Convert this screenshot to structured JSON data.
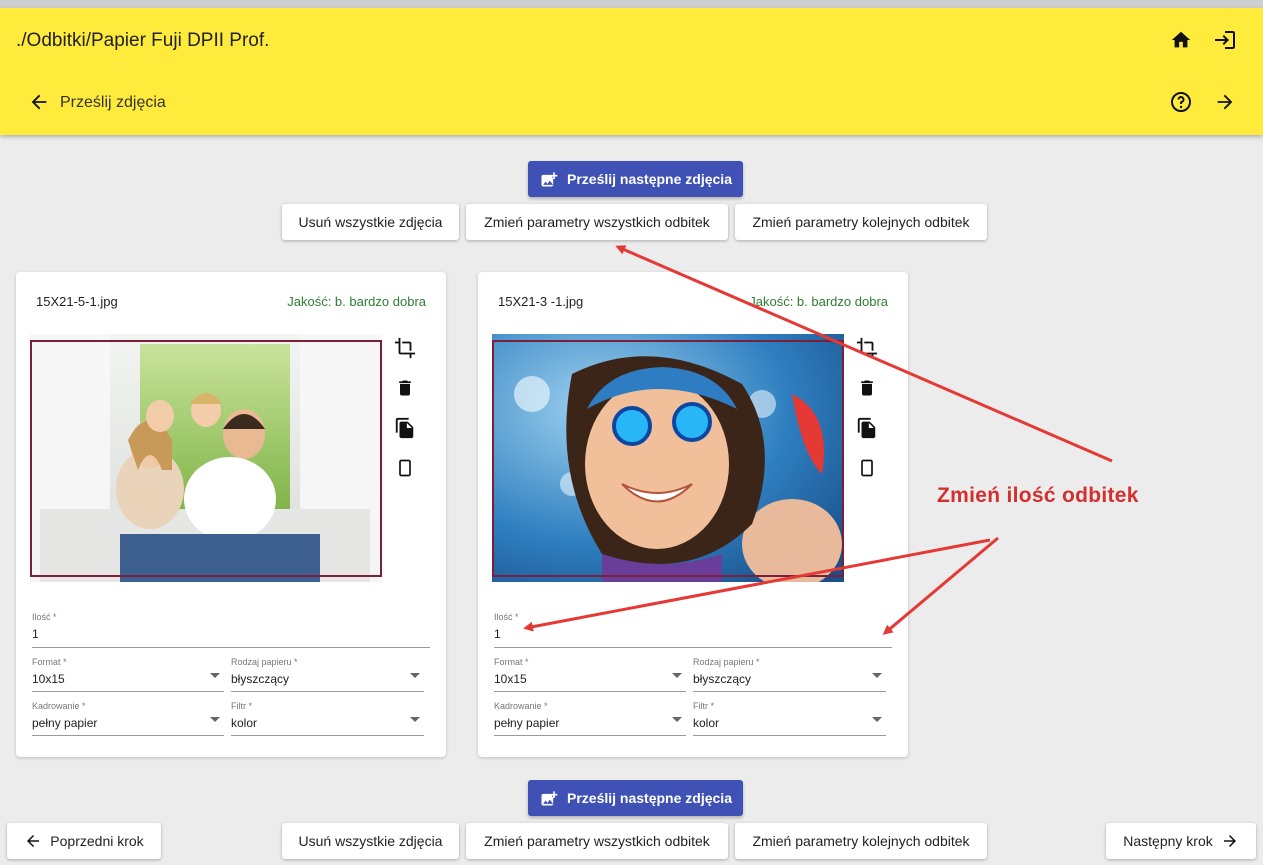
{
  "header": {
    "path": "./Odbitki/Papier Fuji DPII Prof.",
    "subtitle": "Prześlij zdjęcia",
    "icons": [
      "home-icon",
      "login-icon",
      "arrow-back-icon",
      "help-icon",
      "arrow-forward-icon"
    ]
  },
  "toolbar_top": {
    "upload_more": "Prześlij następne zdjęcia",
    "delete_all": "Usuń wszystkie zdjęcia",
    "change_all": "Zmień parametry wszystkich odbitek",
    "change_next": "Zmień parametry kolejnych odbitek"
  },
  "cards": [
    {
      "filename": "15X21-5-1.jpg",
      "quality": "Jakość: b. bardzo dobra",
      "qty_label": "Ilość *",
      "qty_value": "1",
      "format_label": "Format *",
      "format_value": "10x15",
      "paper_label": "Rodzaj papieru *",
      "paper_value": "błyszczący",
      "crop_label": "Kadrowanie *",
      "crop_value": "pełny papier",
      "filter_label": "Filtr *",
      "filter_value": "kolor"
    },
    {
      "filename": "15X21-3 -1.jpg",
      "quality": "Jakość: b. bardzo dobra",
      "qty_label": "Ilość *",
      "qty_value": "1",
      "format_label": "Format *",
      "format_value": "10x15",
      "paper_label": "Rodzaj papieru *",
      "paper_value": "błyszczący",
      "crop_label": "Kadrowanie *",
      "crop_value": "pełny papier",
      "filter_label": "Filtr *",
      "filter_value": "kolor"
    }
  ],
  "annotation": "Zmień ilość odbitek",
  "toolbar_bottom": {
    "prev": "Poprzedni krok",
    "upload_more": "Prześlij następne zdjęcia",
    "delete_all": "Usuń wszystkie zdjęcia",
    "change_all": "Zmień parametry wszystkich odbitek",
    "change_next": "Zmień parametry kolejnych odbitek",
    "next": "Następny krok"
  },
  "colors": {
    "header": "#ffeb3b",
    "primary": "#3f51b5",
    "quality": "#2e7d32",
    "annotation": "#d32f2f",
    "frame": "#7b1f3a"
  }
}
